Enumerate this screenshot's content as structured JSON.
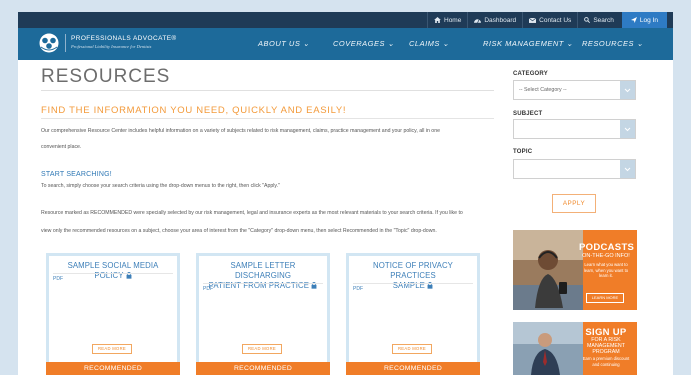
{
  "topbar": {
    "links": [
      {
        "label": "Home",
        "icon": "home-icon"
      },
      {
        "label": "Dashboard",
        "icon": "dashboard-icon"
      },
      {
        "label": "Contact Us",
        "icon": "envelope-icon"
      },
      {
        "label": "Search",
        "icon": "search-icon"
      },
      {
        "label": "Log In",
        "icon": "login-icon"
      }
    ]
  },
  "brand": {
    "name": "PROFESSIONALS ADVOCATE®",
    "tagline": "Professional Liability Insurance for Dentists"
  },
  "nav": {
    "items": [
      "ABOUT US ⌄",
      "COVERAGES ⌄",
      "CLAIMS ⌄",
      "RISK MANAGEMENT ⌄",
      "RESOURCES ⌄"
    ]
  },
  "page": {
    "title": "RESOURCES",
    "subtitle": "FIND THE INFORMATION YOU NEED, QUICKLY AND EASILY!",
    "intro_1": "Our comprehensive Resource Center includes helpful information on a variety of subjects related to risk management, claims, practice management and your policy, all in one",
    "intro_2": "convenient place.",
    "start_heading": "START SEARCHING!",
    "start_text": "To search, simply choose your search criteria using the drop-down menus to the right, then click \"Apply.\"",
    "rec_1": "Resource marked as RECOMMENDED were specially selected by our risk management, legal and insurance experts as the most relevant materials to your search criteria. If you like to",
    "rec_2": "view only the recommended resources on a subject, choose your area of interest from the \"Category\" drop-down menu, then select Recommended in the \"Topic\" drop-down."
  },
  "cards": [
    {
      "title_1": "SAMPLE SOCIAL MEDIA POLICY",
      "title_2": "",
      "type": "PDF",
      "read_more": "READ MORE",
      "badge": "RECOMMENDED"
    },
    {
      "title_1": "SAMPLE LETTER DISCHARGING",
      "title_2": "PATIENT FROM PRACTICE",
      "type": "PDF",
      "read_more": "READ MORE",
      "badge": "RECOMMENDED"
    },
    {
      "title_1": "NOTICE OF PRIVACY PRACTICES",
      "title_2": "SAMPLE",
      "type": "PDF",
      "read_more": "READ MORE",
      "badge": "RECOMMENDED"
    }
  ],
  "sidebar": {
    "category_label": "CATEGORY",
    "category_value": "-- Select Category --",
    "subject_label": "SUBJECT",
    "subject_value": "",
    "topic_label": "TOPIC",
    "topic_value": "",
    "apply_label": "APPLY"
  },
  "promos": [
    {
      "title": "PODCASTS",
      "subtitle": "ON-THE-GO INFO!",
      "body": "Learn what you want to learn, when you want to learn it.",
      "button": "LEARN MORE"
    },
    {
      "title": "SIGN UP",
      "subtitle": "FOR A RISK MANAGEMENT PROGRAM",
      "body": "Earn a premium discount and continuing"
    }
  ],
  "colors": {
    "topbar": "#1f3b57",
    "navbar": "#1d6a9a",
    "accent_orange": "#f07d28",
    "link_blue": "#3d7fb8",
    "page_bg": "#d5e3ef"
  }
}
